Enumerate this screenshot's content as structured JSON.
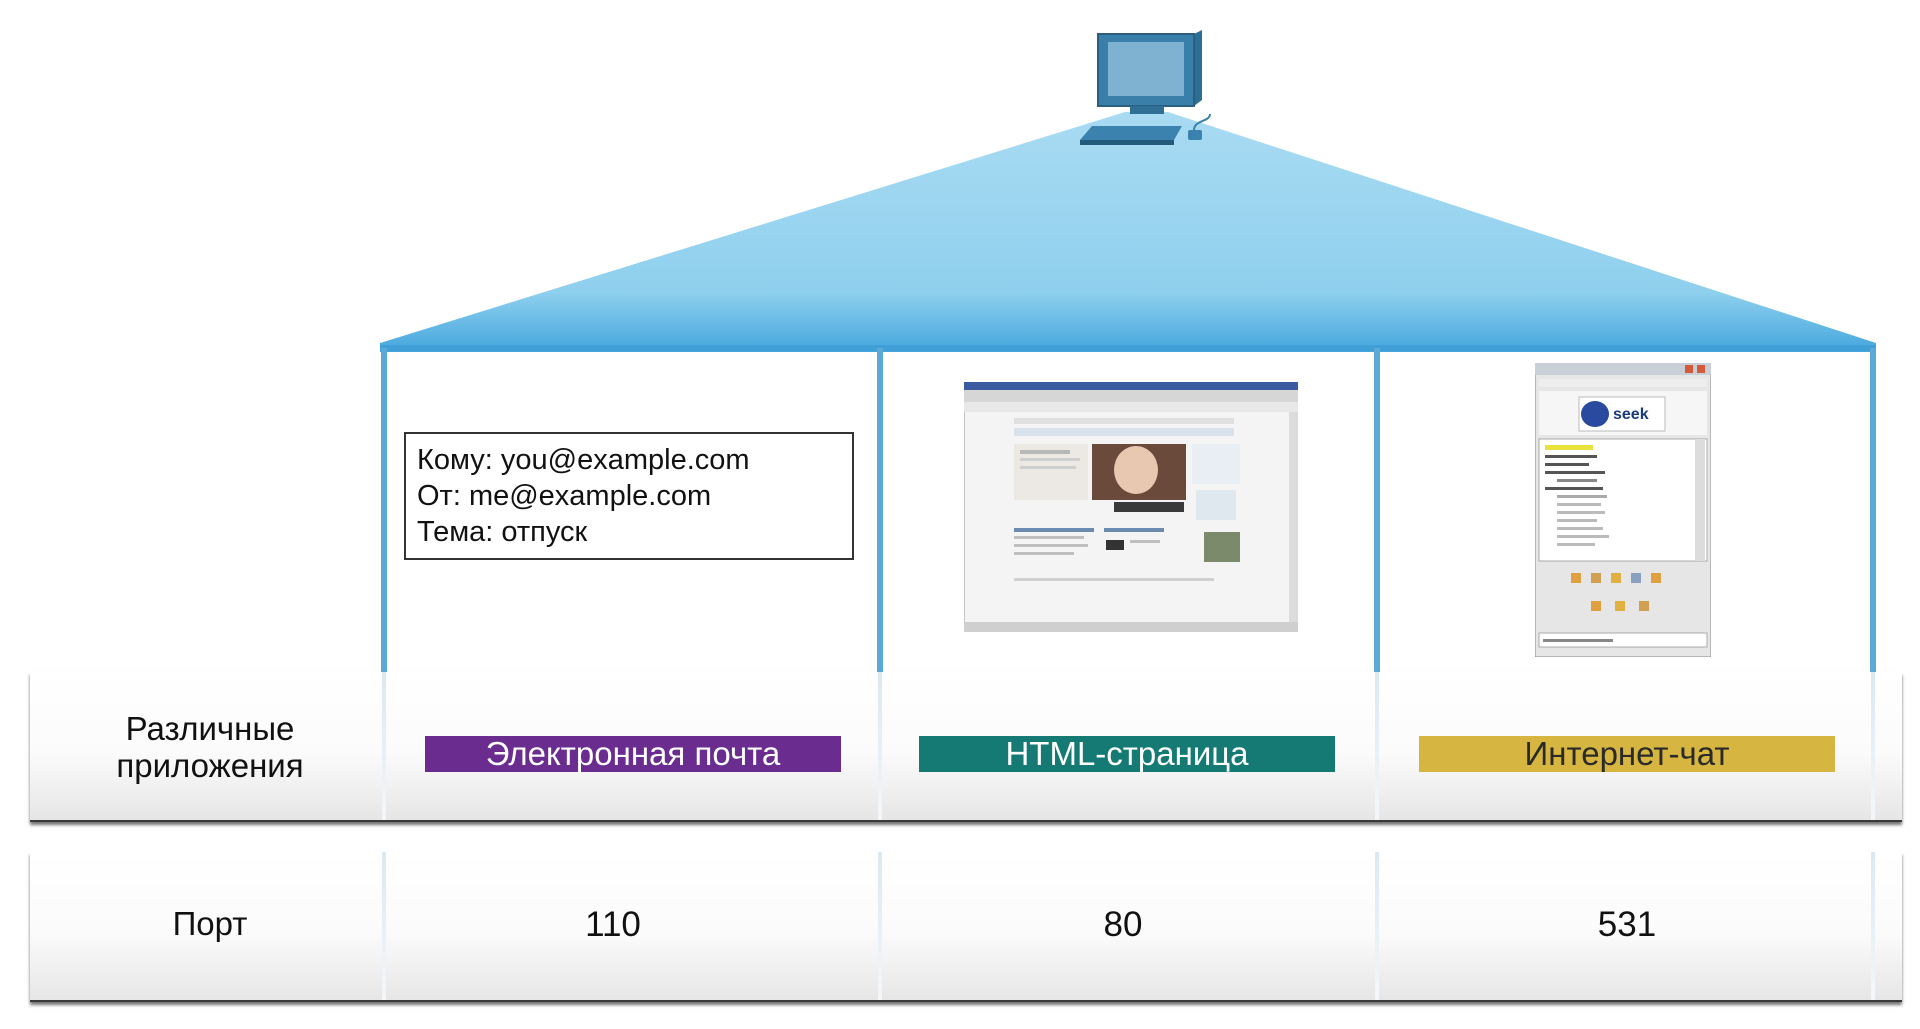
{
  "email": {
    "to": "Кому: you@example.com",
    "from": "От: me@example.com",
    "subject": "Тема: отпуск"
  },
  "rows": {
    "apps_label_line1": "Различные",
    "apps_label_line2": "приложения",
    "port_label": "Порт"
  },
  "apps": [
    {
      "label": "Электронная почта",
      "color": "#6a2c8e",
      "port": "110",
      "text_color": "#ffffff"
    },
    {
      "label": "HTML-страница",
      "color": "#147a73",
      "port": "80",
      "text_color": "#ffffff"
    },
    {
      "label": "Интернет-чат",
      "color": "#d6b640",
      "port": "531",
      "text_color": "#2a2a2a"
    }
  ],
  "chat_thumb": {
    "logo_text": "seek"
  },
  "colors": {
    "roof": "#7cc3e6",
    "roof_edge": "#4aa8da",
    "column_line": "#5aa9d6"
  }
}
